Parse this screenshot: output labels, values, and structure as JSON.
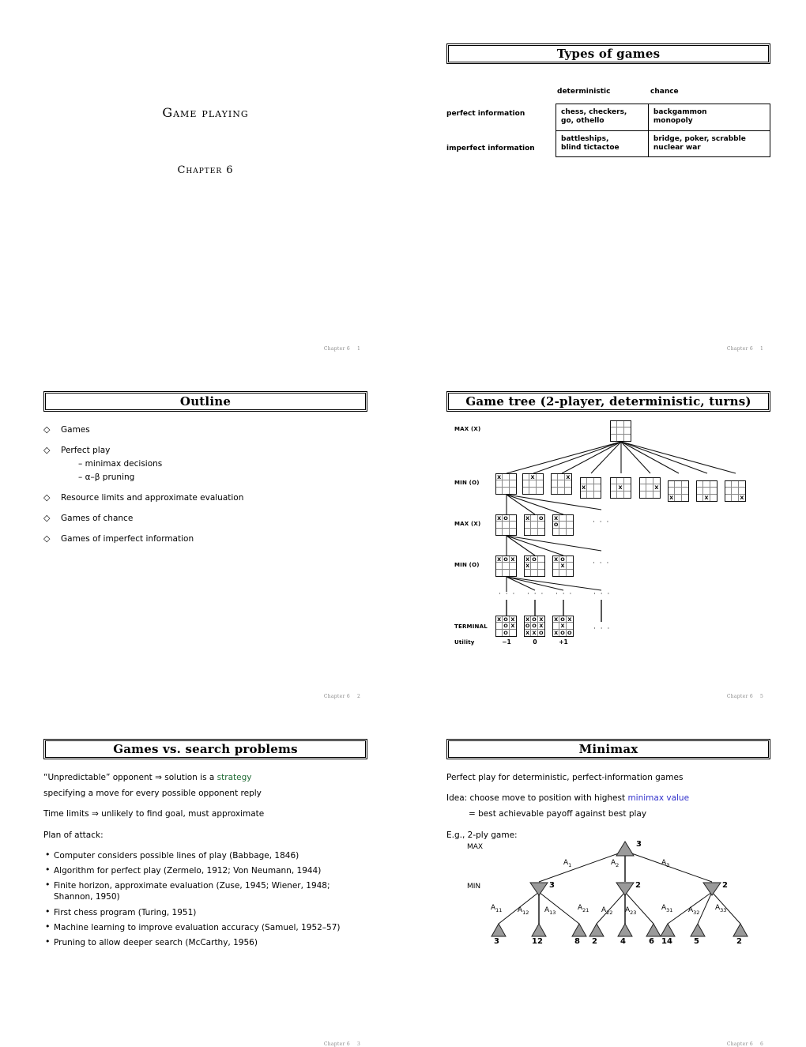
{
  "document": {
    "footer_prefix": "Chapter 6"
  },
  "slides": [
    {
      "id": "title",
      "main_title": "Game playing",
      "chapter_title": "Chapter 6",
      "page": "1"
    },
    {
      "id": "types-of-games",
      "title": "Types of games",
      "page": "1",
      "table": {
        "col_headers": [
          "deterministic",
          "chance"
        ],
        "row_headers": [
          "perfect information",
          "imperfect information"
        ],
        "cells": [
          [
            "chess, checkers,\ngo, othello",
            "backgammon\nmonopoly"
          ],
          [
            "battleships,\nblind tictactoe",
            "bridge, poker, scrabble\nnuclear war"
          ]
        ]
      }
    },
    {
      "id": "outline",
      "title": "Outline",
      "page": "2",
      "items": [
        {
          "label": "Games",
          "sub": []
        },
        {
          "label": "Perfect play",
          "sub": [
            "– minimax decisions",
            "– α–β pruning"
          ]
        },
        {
          "label": "Resource limits and approximate evaluation",
          "sub": []
        },
        {
          "label": "Games of chance",
          "sub": []
        },
        {
          "label": "Games of imperfect information",
          "sub": []
        }
      ]
    },
    {
      "id": "game-tree",
      "title": "Game tree (2-player, deterministic, turns)",
      "page": "5",
      "row_labels": [
        "MAX (X)",
        "MIN (O)",
        "MAX (X)",
        "MIN (O)",
        "TERMINAL"
      ],
      "utility_label": "Utility",
      "utility_values": [
        "−1",
        "0",
        "+1"
      ],
      "ellipsis": "· · ·",
      "boards": {
        "root": [
          "",
          "",
          "",
          "",
          "",
          "",
          "",
          "",
          ""
        ],
        "min1": [
          [
            "X",
            "",
            "",
            "",
            "",
            "",
            "",
            "",
            ""
          ],
          [
            "",
            "X",
            "",
            "",
            "",
            "",
            "",
            "",
            ""
          ],
          [
            "",
            "",
            "X",
            "",
            "",
            "",
            "",
            "",
            ""
          ],
          [
            "",
            "",
            "",
            "X",
            "",
            "",
            "",
            "",
            ""
          ],
          [
            "",
            "",
            "",
            "",
            "X",
            "",
            "",
            "",
            ""
          ],
          [
            "",
            "",
            "",
            "",
            "",
            "X",
            "",
            "",
            ""
          ],
          [
            "",
            "",
            "",
            "",
            "",
            "",
            "X",
            "",
            ""
          ],
          [
            "",
            "",
            "",
            "",
            "",
            "",
            "",
            "X",
            ""
          ],
          [
            "",
            "",
            "",
            "",
            "",
            "",
            "",
            "",
            "X"
          ]
        ],
        "max2": [
          [
            "X",
            "O",
            "",
            "",
            "",
            "",
            "",
            "",
            ""
          ],
          [
            "X",
            "",
            "O",
            "",
            "",
            "",
            "",
            "",
            ""
          ],
          [
            "X",
            "",
            "",
            "O",
            "",
            "",
            "",
            "",
            ""
          ]
        ],
        "min3": [
          [
            "X",
            "O",
            "X",
            "",
            "",
            "",
            "",
            "",
            ""
          ],
          [
            "X",
            "O",
            "",
            "X",
            "",
            "",
            "",
            "",
            ""
          ],
          [
            "X",
            "O",
            "",
            "",
            "X",
            "",
            "",
            "",
            ""
          ]
        ],
        "terminal": [
          [
            "X",
            "O",
            "X",
            "",
            "O",
            "X",
            "",
            "O",
            ""
          ],
          [
            "X",
            "O",
            "X",
            "O",
            "O",
            "X",
            "X",
            "X",
            "O"
          ],
          [
            "X",
            "O",
            "X",
            "",
            "X",
            "",
            "X",
            "O",
            "O"
          ]
        ]
      }
    },
    {
      "id": "games-vs-search",
      "title": "Games vs. search problems",
      "page": "3",
      "para1_a": "“Unpredictable” opponent ⇒ solution is a ",
      "para1_hl": "strategy",
      "para1_b": "specifying a move for every possible opponent reply",
      "para2": "Time limits ⇒ unlikely to find goal, must approximate",
      "para3": "Plan of attack:",
      "bullets": [
        "Computer considers possible lines of play (Babbage, 1846)",
        "Algorithm for perfect play (Zermelo, 1912; Von Neumann, 1944)",
        "Finite horizon, approximate evaluation (Zuse, 1945; Wiener, 1948; Shannon, 1950)",
        "First chess program (Turing, 1951)",
        "Machine learning to improve evaluation accuracy (Samuel, 1952–57)",
        "Pruning to allow deeper search (McCarthy, 1956)"
      ]
    },
    {
      "id": "minimax",
      "title": "Minimax",
      "page": "6",
      "para1": "Perfect play for deterministic, perfect-information games",
      "para2_a": "Idea: choose move to position with highest ",
      "para2_hl": "minimax value",
      "para2_b": "= best achievable payoff against best play",
      "para3": "E.g., 2-ply game:"
    }
  ],
  "colors": {
    "strategy_green": "#1f6b34",
    "minimax_blue": "#3333cc",
    "triangle_fill": "#9a9a9a",
    "rule_black": "#000000"
  },
  "chart_data": {
    "type": "tree",
    "title": "E.g., 2-ply game minimax tree",
    "levels": [
      "MAX",
      "MIN",
      "leaves"
    ],
    "root": {
      "label": "MAX",
      "value": 3
    },
    "edge_labels_top": [
      "A",
      "A",
      "A"
    ],
    "edge_labels_top_sub": [
      "1",
      "2",
      "3"
    ],
    "min_nodes": [
      {
        "value": 3,
        "edge_labels": [
          "A",
          "A",
          "A"
        ],
        "edge_subs": [
          "11",
          "12",
          "13"
        ],
        "leaves": [
          3,
          12,
          8
        ]
      },
      {
        "value": 2,
        "edge_labels": [
          "A",
          "A",
          "A"
        ],
        "edge_subs": [
          "21",
          "22",
          "23"
        ],
        "leaves": [
          2,
          4,
          6
        ]
      },
      {
        "value": 2,
        "edge_labels": [
          "A",
          "A",
          "A"
        ],
        "edge_subs": [
          "31",
          "32",
          "33"
        ],
        "leaves": [
          14,
          5,
          2
        ]
      }
    ],
    "leaf_values": [
      3,
      12,
      8,
      2,
      4,
      6,
      14,
      5,
      2
    ]
  }
}
